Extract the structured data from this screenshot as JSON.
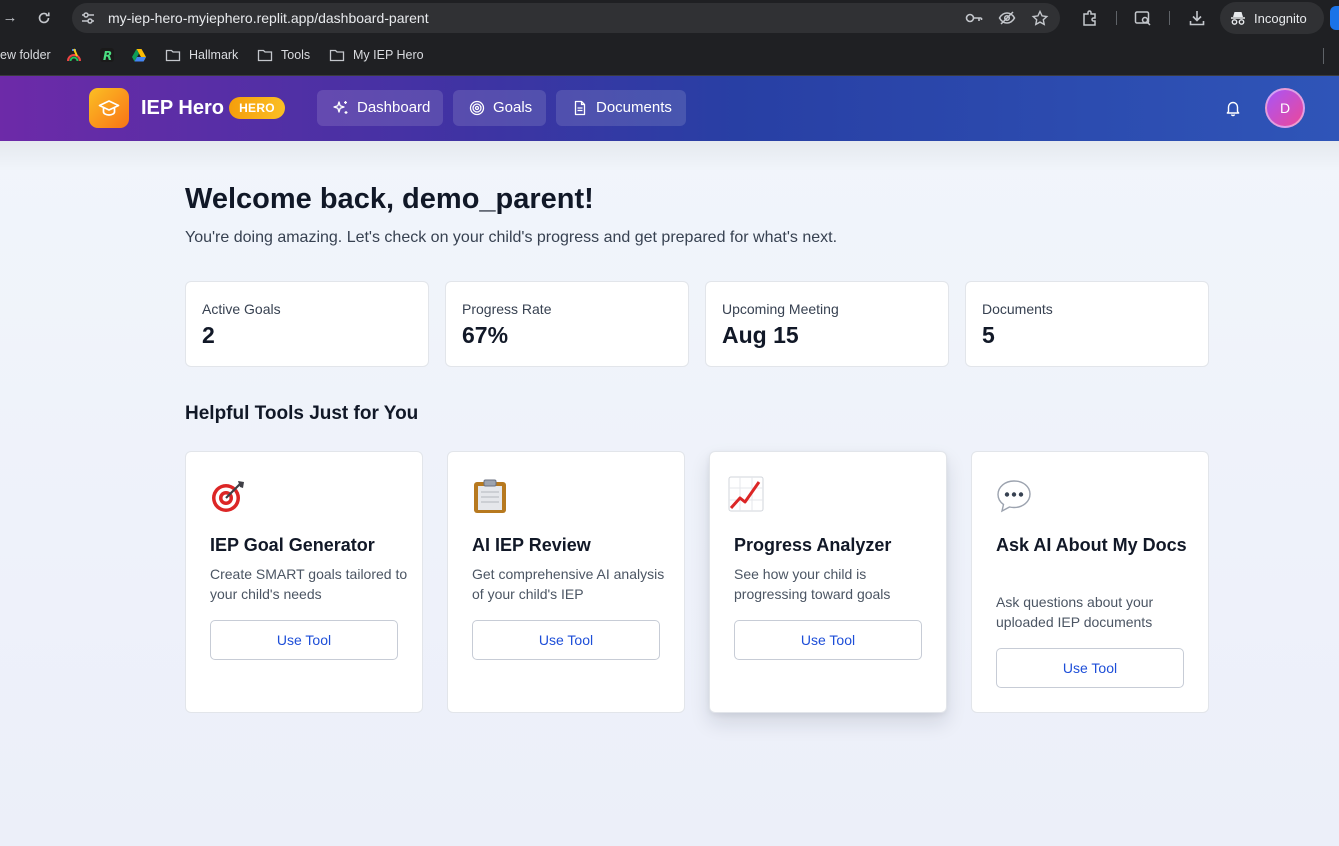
{
  "browser": {
    "url": "my-iep-hero-myiephero.replit.app/dashboard-parent",
    "incognito_label": "Incognito",
    "bookmarks": [
      "ew folder",
      "Hallmark",
      "Tools",
      "My IEP Hero"
    ]
  },
  "header": {
    "brand": "IEP Hero",
    "badge": "HERO",
    "nav": [
      "Dashboard",
      "Goals",
      "Documents"
    ],
    "avatar_initial": "D"
  },
  "main": {
    "welcome": "Welcome back, demo_parent!",
    "subtitle": "You're doing amazing. Let's check on your child's progress and get prepared for what's next.",
    "stats": [
      {
        "label": "Active Goals",
        "value": "2"
      },
      {
        "label": "Progress Rate",
        "value": "67%"
      },
      {
        "label": "Upcoming Meeting",
        "value": "Aug 15"
      },
      {
        "label": "Documents",
        "value": "5"
      }
    ],
    "tools_title": "Helpful Tools Just for You",
    "tools": [
      {
        "icon": "target-icon",
        "title": "IEP Goal Generator",
        "desc": "Create SMART goals tailored to your child's needs",
        "button": "Use Tool"
      },
      {
        "icon": "clipboard-icon",
        "title": "AI IEP Review",
        "desc": "Get comprehensive AI analysis of your child's IEP",
        "button": "Use Tool"
      },
      {
        "icon": "chart-increasing-icon",
        "title": "Progress Analyzer",
        "desc": "See how your child is progressing toward goals",
        "button": "Use Tool"
      },
      {
        "icon": "speech-bubble-icon",
        "title": "Ask AI About My Docs",
        "desc": "Ask questions about your uploaded IEP documents",
        "button": "Use Tool"
      }
    ]
  },
  "colors": {
    "header_gradient_start": "#6d2aa8",
    "header_gradient_end": "#2f55b8",
    "badge": "#f59e0b",
    "button_text": "#1d4ed8",
    "page_background": "#eef2f9"
  }
}
